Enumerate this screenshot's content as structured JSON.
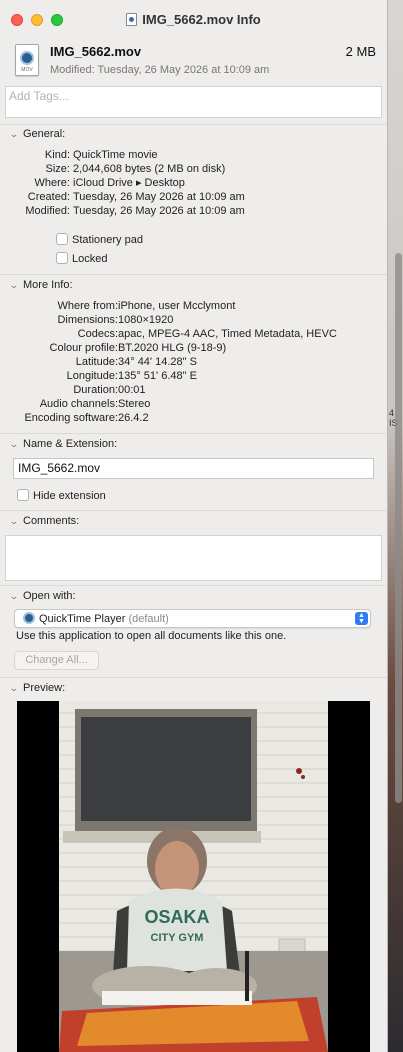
{
  "window": {
    "title": "IMG_5662.mov Info"
  },
  "file": {
    "name": "IMG_5662.mov",
    "size": "2 MB",
    "modified_line": "Modified: Tuesday, 26 May 2026 at 10:09 am",
    "icon_label": "MOV"
  },
  "tags": {
    "placeholder": "Add Tags..."
  },
  "general": {
    "header": "General:",
    "rows": [
      {
        "key": "Kind:",
        "value": "QuickTime movie"
      },
      {
        "key": "Size:",
        "value": "2,044,608 bytes (2 MB on disk)"
      },
      {
        "key": "Where:",
        "value": "iCloud Drive ▸ Desktop"
      },
      {
        "key": "Created:",
        "value": "Tuesday, 26 May 2026 at 10:09 am"
      },
      {
        "key": "Modified:",
        "value": "Tuesday, 26 May 2026 at 10:09 am"
      }
    ],
    "stationery": "Stationery pad",
    "locked": "Locked"
  },
  "more_info": {
    "header": "More Info:",
    "rows": [
      {
        "key": "Where from:",
        "value": "iPhone, user Mcclymont"
      },
      {
        "key": "Dimensions:",
        "value": "1080×1920"
      },
      {
        "key": "Codecs:",
        "value": "apac, MPEG-4 AAC, Timed Metadata, HEVC"
      },
      {
        "key": "Colour profile:",
        "value": "BT.2020 HLG (9-18-9)"
      },
      {
        "key": "Latitude:",
        "value": "34° 44' 14.28\" S"
      },
      {
        "key": "Longitude:",
        "value": "135° 51' 6.48\" E"
      },
      {
        "key": "Duration:",
        "value": "00:01"
      },
      {
        "key": "Audio channels:",
        "value": "Stereo"
      },
      {
        "key": "Encoding software:",
        "value": "26.4.2"
      }
    ]
  },
  "name_ext": {
    "header": "Name & Extension:",
    "value": "IMG_5662.mov",
    "hide_extension": "Hide extension"
  },
  "comments": {
    "header": "Comments:"
  },
  "open_with": {
    "header": "Open with:",
    "app": "QuickTime Player",
    "default_tag": "(default)",
    "description": "Use this application to open all documents like this one.",
    "change_all": "Change All..."
  },
  "preview": {
    "header": "Preview:",
    "shirt_text_1": "OSAKA",
    "shirt_text_2": "CITY GYM"
  },
  "background": {
    "strip_text_1": "4",
    "strip_text_2": "IS"
  }
}
